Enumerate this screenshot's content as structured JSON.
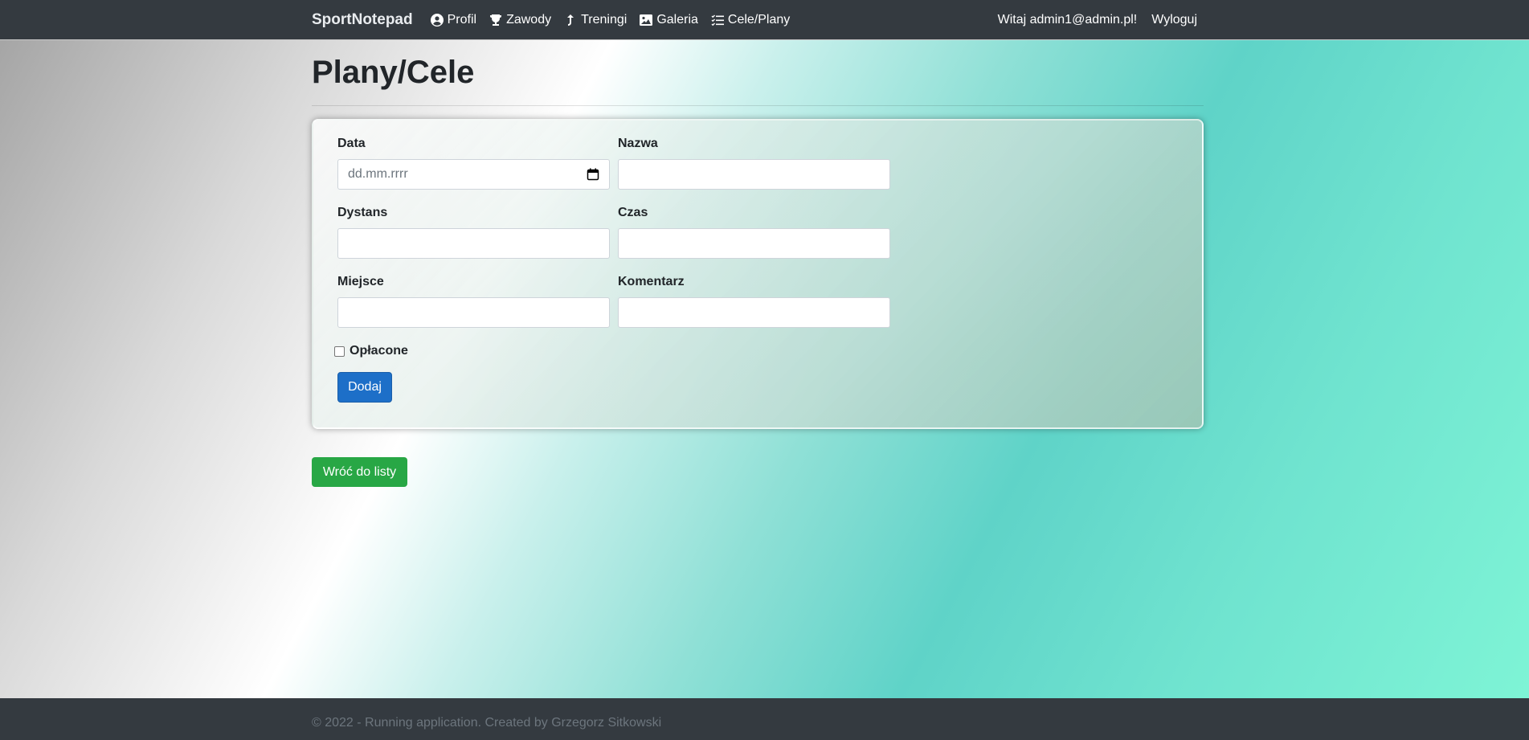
{
  "navbar": {
    "brand": "SportNotepad",
    "links": [
      {
        "label": "Profil",
        "icon": "user-circle-icon"
      },
      {
        "label": "Zawody",
        "icon": "trophy-icon"
      },
      {
        "label": "Treningi",
        "icon": "arrow-up-right-icon"
      },
      {
        "label": "Galeria",
        "icon": "image-icon"
      },
      {
        "label": "Cele/Plany",
        "icon": "list-check-icon"
      }
    ],
    "greeting": "Witaj admin1@admin.pl!",
    "logout": "Wyloguj"
  },
  "page": {
    "title": "Plany/Cele"
  },
  "form": {
    "fields": {
      "date": {
        "label": "Data",
        "placeholder": "dd.mm.rrrr",
        "value": ""
      },
      "name": {
        "label": "Nazwa",
        "value": ""
      },
      "distance": {
        "label": "Dystans",
        "value": ""
      },
      "time": {
        "label": "Czas",
        "value": ""
      },
      "place": {
        "label": "Miejsce",
        "value": ""
      },
      "comment": {
        "label": "Komentarz",
        "value": ""
      }
    },
    "paid": {
      "label": "Opłacone",
      "checked": false
    },
    "submit_label": "Dodaj"
  },
  "back_button": "Wróć do listy",
  "footer": {
    "text": "© 2022 - Running application. Created by Grzegorz Sitkowski"
  },
  "colors": {
    "navbar": "#343a40",
    "primary": "#1d6fc8",
    "success": "#28a745"
  }
}
